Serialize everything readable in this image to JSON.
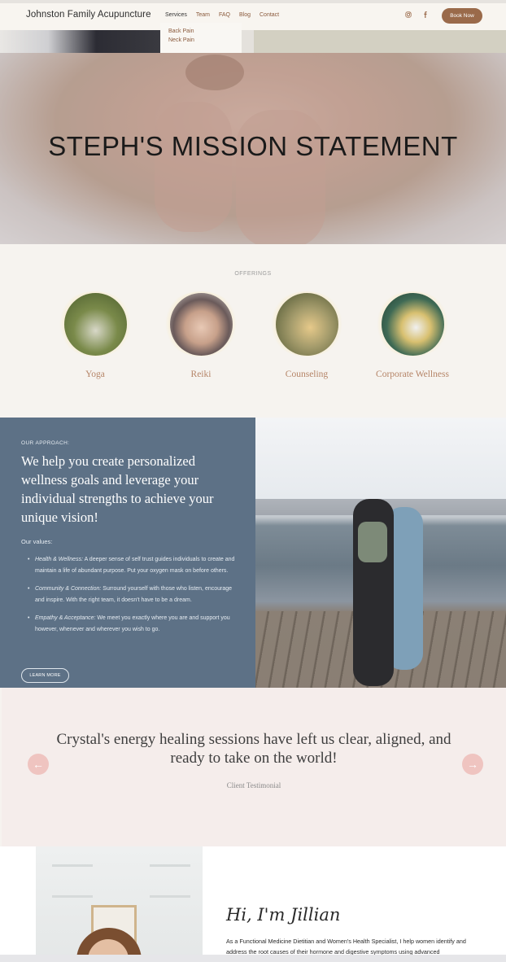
{
  "header": {
    "brand": "Johnston Family Acupuncture",
    "nav": [
      {
        "label": "Services",
        "active": true
      },
      {
        "label": "Team"
      },
      {
        "label": "FAQ"
      },
      {
        "label": "Blog"
      },
      {
        "label": "Contact"
      }
    ],
    "social_icons": [
      "instagram-icon",
      "facebook-icon"
    ],
    "book_button": "Book Now"
  },
  "dropdown": {
    "items": [
      "Back Pain",
      "Neck Pain"
    ]
  },
  "hero": {
    "title": "STEPH'S MISSION STATEMENT"
  },
  "offerings": {
    "label": "OFFERINGS",
    "items": [
      {
        "name": "Yoga",
        "color": "#5a6b3a"
      },
      {
        "name": "Reiki",
        "color": "#b48e78"
      },
      {
        "name": "Counseling",
        "color": "#8c8a5a"
      },
      {
        "name": "Corporate Wellness",
        "color": "#3a5a4a"
      }
    ]
  },
  "approach": {
    "label": "OUR APPROACH:",
    "heading": "We help you create personalized wellness goals and leverage your individual strengths to achieve your unique vision!",
    "values_label": "Our values:",
    "values": [
      {
        "title": "Health & Wellness:",
        "text": " A deeper sense of self trust guides individuals to create and maintain a life of abundant purpose. Put your oxygen mask on before others."
      },
      {
        "title": "Community & Connection:",
        "text": " Surround yourself with those who listen, encourage and inspire.  With the right team, it doesn't have to be a dream."
      },
      {
        "title": "Empathy & Acceptance:",
        "text": " We meet you exactly where you are and support you however, whenever and wherever you wish to go."
      }
    ],
    "button": "LEARN MORE",
    "background": "#5d7186"
  },
  "testimonial": {
    "quote": "Crystal's energy healing sessions have left us clear, aligned, and ready to take on the world!",
    "source": "Client Testimonial",
    "prev_icon": "arrow-left-icon",
    "next_icon": "arrow-right-icon"
  },
  "intro": {
    "greeting": "Hi, I'm Jillian",
    "bio": "As a Functional Medicine Dietitian and Women's Health Specialist, I help women identify and address the root causes of their hormone and digestive symptoms using advanced"
  }
}
